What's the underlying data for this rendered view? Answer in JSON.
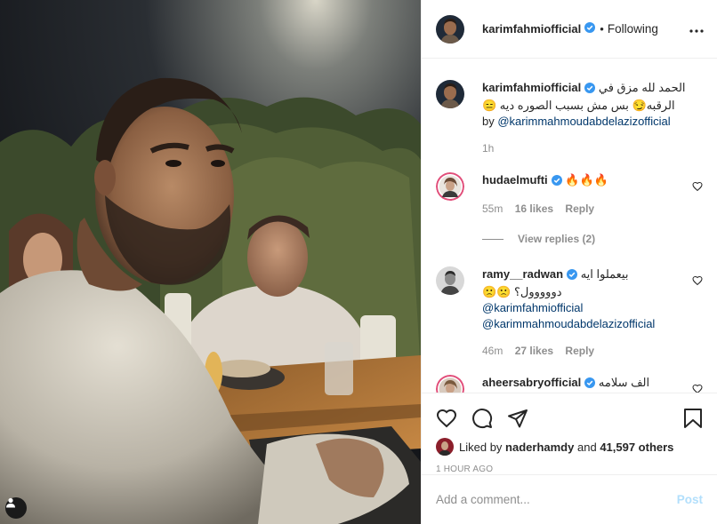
{
  "header": {
    "username": "karimfahmiofficial",
    "separator": "•",
    "follow_label": "Following",
    "more_icon": "more-horizontal-icon"
  },
  "caption": {
    "username": "karimfahmiofficial",
    "text_line1": "الحمد لله مزق في",
    "text_line2": "الرقبه😏 بس مش بسبب الصوره ديه 😑",
    "by_label": "by",
    "mention": "@karimmahmoudabdelazizofficial",
    "time": "1h"
  },
  "comments": [
    {
      "username": "hudaelmufti",
      "text": "🔥🔥🔥",
      "time": "55m",
      "likes": "16 likes",
      "reply_label": "Reply",
      "view_replies": "View replies (2)"
    },
    {
      "username": "ramy__radwan",
      "text_line1": "بيعملوا ايه",
      "text_line2": "دووووول؟ 🙁🙁",
      "mention1": "@karimfahmiofficial",
      "mention2": "@karimmahmoudabdelazizofficial",
      "time": "46m",
      "likes": "27 likes",
      "reply_label": "Reply"
    },
    {
      "username": "aheersabryofficial",
      "text": "الف سلامه"
    }
  ],
  "likes_row": {
    "prefix": "Liked by",
    "user": "naderhamdy",
    "and": "and",
    "count": "41,597 others"
  },
  "timestamp": "1 HOUR AGO",
  "comment_box": {
    "placeholder": "Add a comment...",
    "post_label": "Post"
  },
  "colors": {
    "verified": "#3897f0",
    "link": "#00376b",
    "muted": "#8e8e8e",
    "post_disabled": "#b2dffc"
  }
}
